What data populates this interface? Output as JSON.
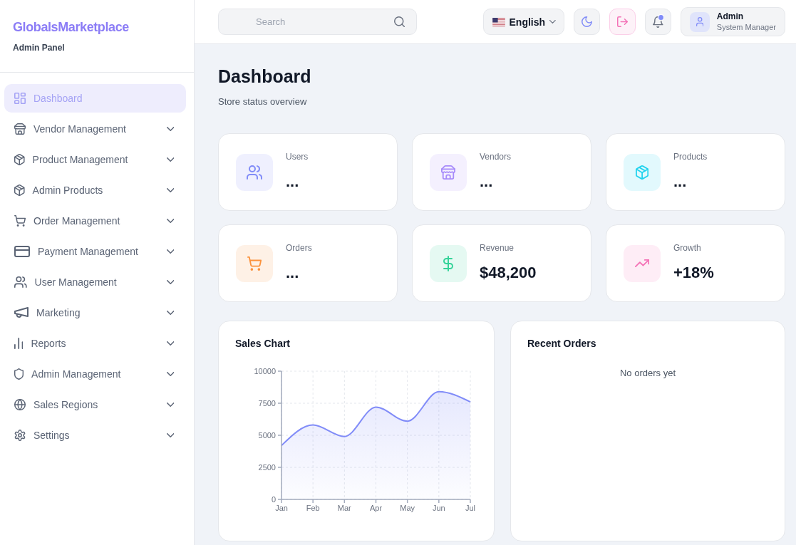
{
  "sidebar": {
    "brand": "GlobalsMarketplace",
    "subtitle": "Admin Panel",
    "items": [
      {
        "label": "Dashboard",
        "selected": true,
        "has_submenu": false
      },
      {
        "label": "Vendor Management",
        "selected": false,
        "has_submenu": true
      },
      {
        "label": "Product Management",
        "selected": false,
        "has_submenu": true
      },
      {
        "label": "Admin Products",
        "selected": false,
        "has_submenu": true
      },
      {
        "label": "Order Management",
        "selected": false,
        "has_submenu": true
      },
      {
        "label": "Payment Management",
        "selected": false,
        "has_submenu": true
      },
      {
        "label": "User Management",
        "selected": false,
        "has_submenu": true
      },
      {
        "label": "Marketing",
        "selected": false,
        "has_submenu": true
      },
      {
        "label": "Reports",
        "selected": false,
        "has_submenu": true
      },
      {
        "label": "Admin Management",
        "selected": false,
        "has_submenu": true
      },
      {
        "label": "Sales Regions",
        "selected": false,
        "has_submenu": true
      },
      {
        "label": "Settings",
        "selected": false,
        "has_submenu": true
      }
    ]
  },
  "header": {
    "search": {
      "placeholder": "Search"
    },
    "language": {
      "label": "English"
    },
    "notifications": {
      "unread": true
    },
    "user": {
      "name": "Admin",
      "role": "System Manager"
    }
  },
  "page": {
    "title": "Dashboard",
    "subtitle": "Store status overview"
  },
  "stats": [
    {
      "label": "Users",
      "value": "...",
      "color": "#818cf8"
    },
    {
      "label": "Vendors",
      "value": "...",
      "color": "#a78bfa"
    },
    {
      "label": "Products",
      "value": "...",
      "color": "#22d3ee"
    },
    {
      "label": "Orders",
      "value": "...",
      "color": "#fb923c"
    },
    {
      "label": "Revenue",
      "value": "$48,200",
      "color": "#34d399"
    },
    {
      "label": "Growth",
      "value": "+18%",
      "color": "#f472b6"
    }
  ],
  "sales_chart": {
    "title": "Sales Chart",
    "chart_data": {
      "type": "area",
      "categories": [
        "Jan",
        "Feb",
        "Mar",
        "Apr",
        "May",
        "Jun",
        "Jul"
      ],
      "series": [
        {
          "color": "#818cf8",
          "values": [
            4200,
            5800,
            4900,
            7200,
            6100,
            8400,
            7600
          ]
        }
      ],
      "ylim": [
        0,
        10000
      ],
      "yticks": [
        0,
        2500,
        5000,
        7500,
        10000
      ],
      "grid": true
    }
  },
  "recent_orders": {
    "title": "Recent Orders",
    "empty_text": "No orders yet"
  }
}
